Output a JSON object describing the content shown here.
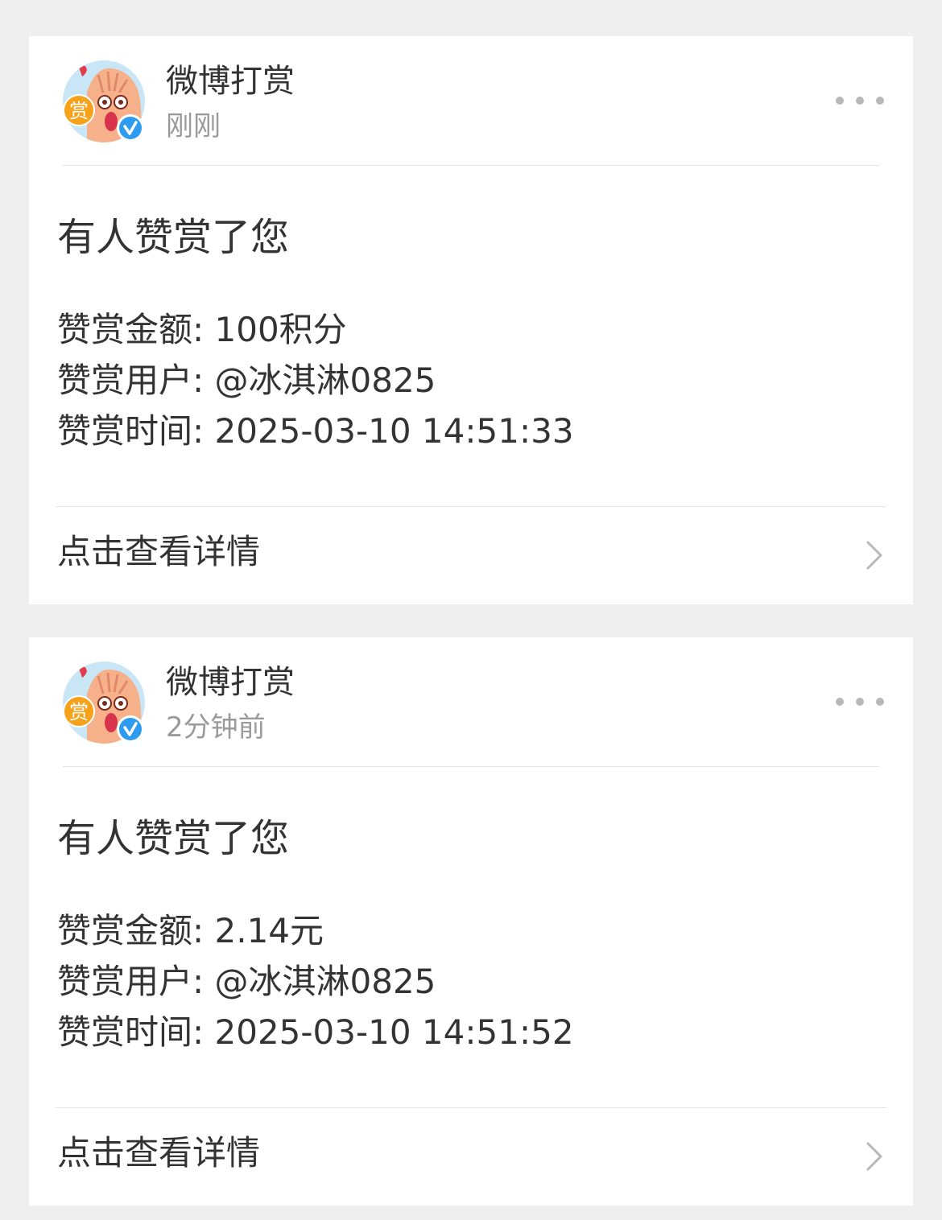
{
  "notifications": [
    {
      "sender_name": "微博打赏",
      "time": "刚刚",
      "title": "有人赞赏了您",
      "amount_line": "赞赏金额: 100积分",
      "user_line": "赞赏用户: @冰淇淋0825",
      "time_line": "赞赏时间: 2025-03-10 14:51:33",
      "view_details_label": "点击查看详情",
      "avatar_badge_text": "赏"
    },
    {
      "sender_name": "微博打赏",
      "time": "2分钟前",
      "title": "有人赞赏了您",
      "amount_line": "赞赏金额: 2.14元",
      "user_line": "赞赏用户: @冰淇淋0825",
      "time_line": "赞赏时间: 2025-03-10 14:51:52",
      "view_details_label": "点击查看详情",
      "avatar_badge_text": "赏"
    }
  ],
  "icons": {
    "more": "more-dots-icon",
    "chevron": "chevron-right-icon",
    "verified": "verified-badge-icon",
    "avatar": "reward-mascot-avatar"
  },
  "colors": {
    "background": "#efefef",
    "card": "#ffffff",
    "text": "#333333",
    "muted_text": "#9a9a9a",
    "verified_blue": "#2d9cf0",
    "badge_orange": "#f7a21b"
  }
}
